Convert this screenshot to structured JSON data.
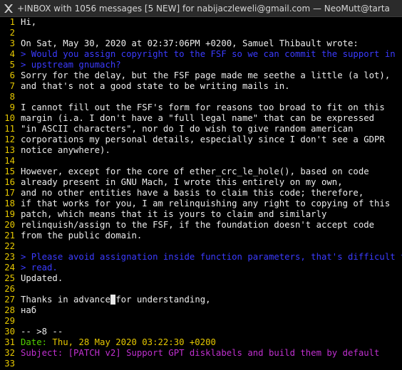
{
  "window": {
    "title": "+INBOX with 1056 messages [5 NEW] for nabijaczleweli@gmail.com — NeoMutt@tarta",
    "icon": "x-window-icon"
  },
  "colors": {
    "background": "#000000",
    "text": "#ececec",
    "line_number": "#e6c800",
    "quote": "#3b3bff",
    "date_header": "#55d200",
    "subject_header": "#c030d0"
  },
  "editor": {
    "lines": [
      {
        "n": "1",
        "text": "Hi,",
        "kind": "normal"
      },
      {
        "n": "2",
        "text": "",
        "kind": "normal"
      },
      {
        "n": "3",
        "text": "On Sat, May 30, 2020 at 02:37:06PM +0200, Samuel Thibault wrote:",
        "kind": "normal"
      },
      {
        "n": "4",
        "text": "> Would you assign copyright to the FSF so we can commit the support in",
        "kind": "quote"
      },
      {
        "n": "5",
        "text": "> upstream gnumach?",
        "kind": "quote"
      },
      {
        "n": "6",
        "text": "Sorry for the delay, but the FSF page made me seethe a little (a lot),",
        "kind": "normal"
      },
      {
        "n": "7",
        "text": "and that's not a good state to be writing mails in.",
        "kind": "normal"
      },
      {
        "n": "8",
        "text": "",
        "kind": "normal"
      },
      {
        "n": "9",
        "text": "I cannot fill out the FSF's form for reasons too broad to fit on this",
        "kind": "normal"
      },
      {
        "n": "10",
        "text": "margin (i.a. I don't have a \"full legal name\" that can be expressed",
        "kind": "normal"
      },
      {
        "n": "11",
        "text": "\"in ASCII characters\", nor do I do wish to give random american",
        "kind": "normal"
      },
      {
        "n": "12",
        "text": "corporations my personal details, especially since I don't see a GDPR",
        "kind": "normal"
      },
      {
        "n": "13",
        "text": "notice anywhere).",
        "kind": "normal"
      },
      {
        "n": "14",
        "text": "",
        "kind": "normal"
      },
      {
        "n": "15",
        "text": "However, except for the core of ether_crc_le_hole(), based on code",
        "kind": "normal"
      },
      {
        "n": "16",
        "text": "already present in GNU Mach, I wrote this entirely on my own,",
        "kind": "normal"
      },
      {
        "n": "17",
        "text": "and no other entities have a basis to claim this code; therefore,",
        "kind": "normal"
      },
      {
        "n": "18",
        "text": "if that works for you, I am relinquishing any right to copying of this",
        "kind": "normal"
      },
      {
        "n": "19",
        "text": "patch, which means that it is yours to claim and similarly",
        "kind": "normal"
      },
      {
        "n": "20",
        "text": "relinquish/assign to the FSF, if the foundation doesn't accept code",
        "kind": "normal"
      },
      {
        "n": "21",
        "text": "from the public domain.",
        "kind": "normal"
      },
      {
        "n": "22",
        "text": "",
        "kind": "normal"
      },
      {
        "n": "23",
        "text": "> Please avoid assignation inside function parameters, that's difficult to",
        "kind": "quote"
      },
      {
        "n": "24",
        "text": "> read.",
        "kind": "quote"
      },
      {
        "n": "25",
        "text": "Updated.",
        "kind": "normal"
      },
      {
        "n": "26",
        "text": "",
        "kind": "normal"
      },
      {
        "n": "27",
        "text": "Thanks in advance for understanding,",
        "kind": "cursor"
      },
      {
        "n": "28",
        "text": "наб",
        "kind": "normal"
      },
      {
        "n": "29",
        "text": "",
        "kind": "normal"
      },
      {
        "n": "30",
        "text": "-- >8 --",
        "kind": "normal"
      },
      {
        "n": "31",
        "text": "Thu, 28 May 2020 03:22:30 +0200",
        "kind": "date",
        "label": "Date: "
      },
      {
        "n": "32",
        "text": "Subject: [PATCH v2] Support GPT disklabels and build them by default",
        "kind": "subject"
      },
      {
        "n": "33",
        "text": "",
        "kind": "normal"
      }
    ],
    "cursor": {
      "line": "27",
      "before": "Thanks in advance",
      "char": " ",
      "after": "for understanding,"
    }
  }
}
